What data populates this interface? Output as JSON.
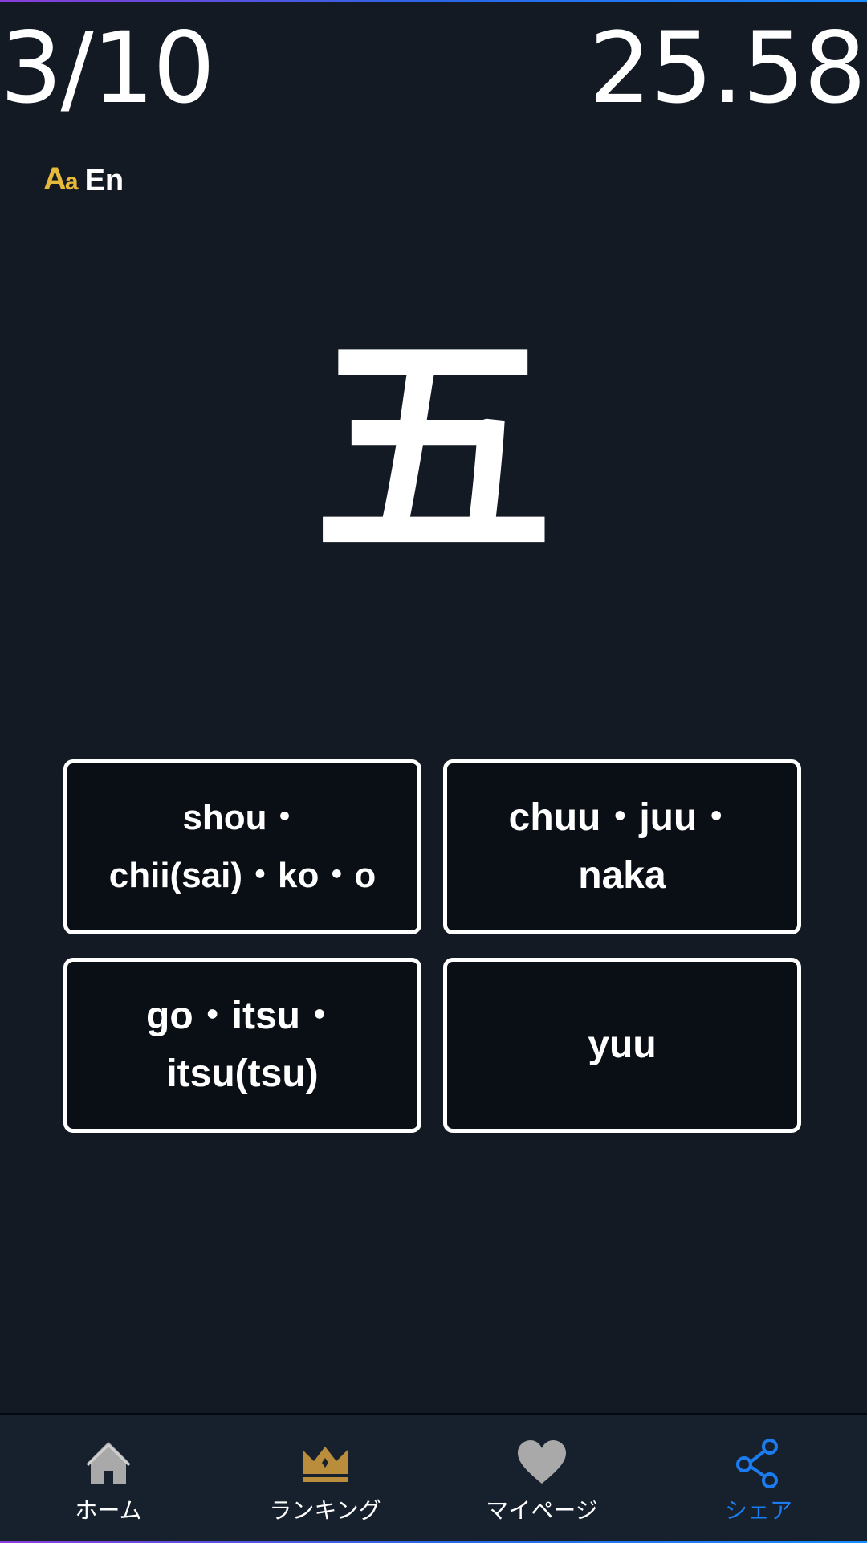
{
  "header": {
    "progress_text": "3/10",
    "timer_text": "25.58"
  },
  "language_toggle": {
    "icon": "font-size-icon",
    "icon_big": "A",
    "icon_small": "a",
    "label": "En"
  },
  "question": {
    "kanji": "五"
  },
  "answers": [
    {
      "line1": "shou・",
      "line2": "chii(sai)・ko・o"
    },
    {
      "line1": "chuu・juu・",
      "line2": "naka"
    },
    {
      "line1": "go・itsu・",
      "line2": "itsu(tsu)"
    },
    {
      "line1": "yuu",
      "line2": ""
    }
  ],
  "bottom_nav": {
    "items": [
      {
        "label": "ホーム",
        "icon": "home-icon"
      },
      {
        "label": "ランキング",
        "icon": "crown-icon"
      },
      {
        "label": "マイページ",
        "icon": "heart-icon"
      },
      {
        "label": "シェア",
        "icon": "share-icon"
      }
    ],
    "active_index": 3
  },
  "colors": {
    "background": "#131a23",
    "accent_active": "#1a7cf0",
    "crown": "#b98d3c",
    "icon_gray": "#a9a9a9",
    "aa_icon": "#e7b93a"
  }
}
